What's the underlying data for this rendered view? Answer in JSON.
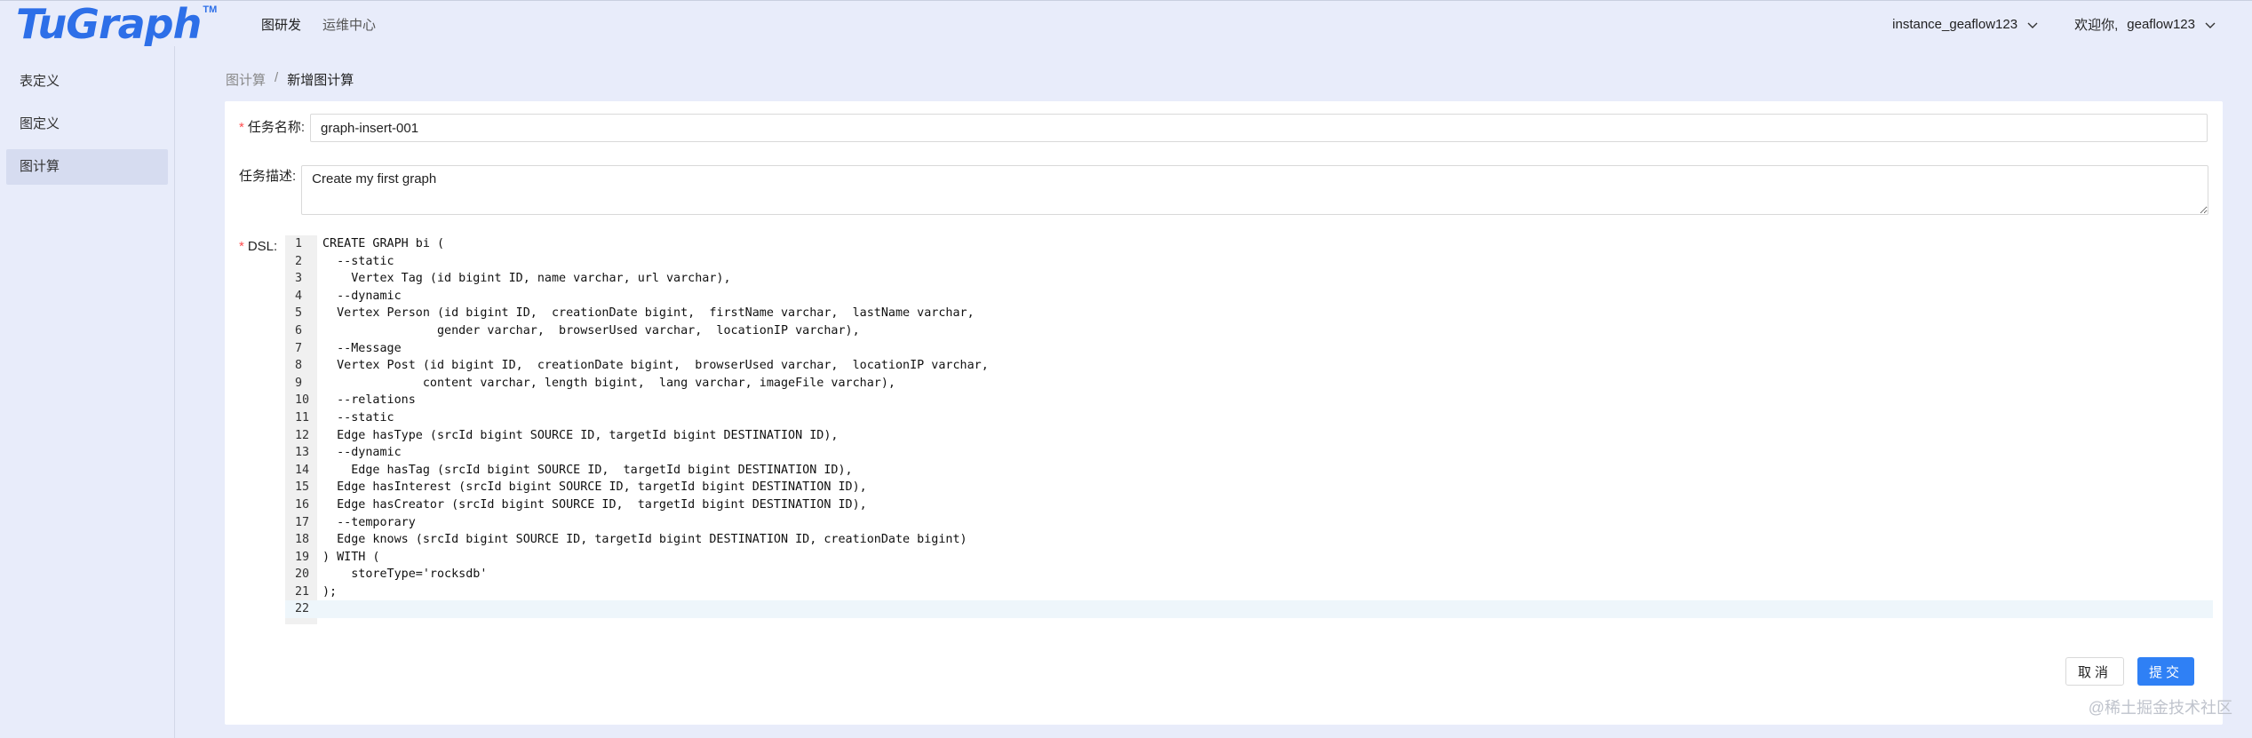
{
  "app": {
    "logo_text": "TuGraph",
    "logo_tm": "TM"
  },
  "nav": {
    "items": [
      {
        "label": "图研发"
      },
      {
        "label": "运维中心"
      }
    ]
  },
  "topright": {
    "instance": "instance_geaflow123",
    "welcome": "欢迎你,",
    "user": "geaflow123"
  },
  "sidebar": {
    "items": [
      {
        "label": "表定义"
      },
      {
        "label": "图定义"
      },
      {
        "label": "图计算",
        "active": true
      }
    ]
  },
  "breadcrumb": {
    "parent": "图计算",
    "separator": "/",
    "current": "新增图计算"
  },
  "form": {
    "task_name_label": "任务名称:",
    "task_name_value": "graph-insert-001",
    "task_desc_label": "任务描述:",
    "task_desc_value": "Create my first graph",
    "dsl_label": "DSL:"
  },
  "editor": {
    "line_numbers": [
      "1",
      "2",
      "3",
      "4",
      "5",
      "6",
      "7",
      "8",
      "9",
      "10",
      "11",
      "12",
      "13",
      "14",
      "15",
      "16",
      "17",
      "18",
      "19",
      "20",
      "21",
      "22"
    ],
    "lines": [
      "CREATE GRAPH bi (",
      "  --static",
      "    Vertex Tag (id bigint ID, name varchar, url varchar),",
      "  --dynamic",
      "  Vertex Person (id bigint ID,  creationDate bigint,  firstName varchar,  lastName varchar,",
      "                gender varchar,  browserUsed varchar,  locationIP varchar),",
      "  --Message",
      "  Vertex Post (id bigint ID,  creationDate bigint,  browserUsed varchar,  locationIP varchar,",
      "              content varchar, length bigint,  lang varchar, imageFile varchar),",
      "  --relations",
      "  --static",
      "  Edge hasType (srcId bigint SOURCE ID, targetId bigint DESTINATION ID),",
      "  --dynamic",
      "    Edge hasTag (srcId bigint SOURCE ID,  targetId bigint DESTINATION ID),",
      "  Edge hasInterest (srcId bigint SOURCE ID, targetId bigint DESTINATION ID),",
      "  Edge hasCreator (srcId bigint SOURCE ID,  targetId bigint DESTINATION ID),",
      "  --temporary",
      "  Edge knows (srcId bigint SOURCE ID, targetId bigint DESTINATION ID, creationDate bigint)",
      ") WITH (",
      "    storeType='rocksdb'",
      ");",
      ""
    ]
  },
  "buttons": {
    "cancel": "取消",
    "submit": "提交"
  },
  "watermark": "@稀土掘金技术社区",
  "colors": {
    "primary": "#2f80f5",
    "background": "#e8ecfa",
    "required": "#ff4d4f"
  }
}
